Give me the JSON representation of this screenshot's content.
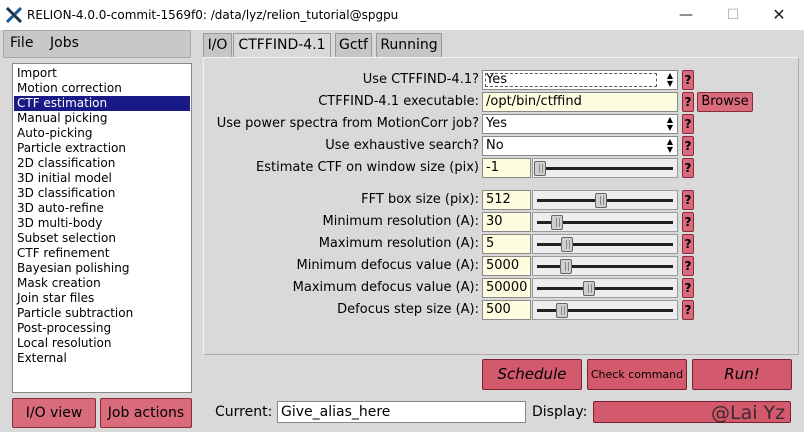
{
  "window": {
    "title": "RELION-4.0.0-commit-1569f0: /data/lyz/relion_tutorial@spgpu",
    "minimize": "—",
    "maximize": "☐",
    "close": "✕"
  },
  "menubar": {
    "file": "File",
    "jobs": "Jobs"
  },
  "job_types": [
    "Import",
    "Motion correction",
    "CTF estimation",
    "Manual picking",
    "Auto-picking",
    "Particle extraction",
    "2D classification",
    "3D initial model",
    "3D classification",
    "3D auto-refine",
    "3D multi-body",
    "Subset selection",
    "CTF refinement",
    "Bayesian polishing",
    "Mask creation",
    "Join star files",
    "Particle subtraction",
    "Post-processing",
    "Local resolution",
    "External"
  ],
  "selected_job_type": "CTF estimation",
  "left_buttons": {
    "io_view": "I/O view",
    "job_actions": "Job actions"
  },
  "tabs": [
    "I/O",
    "CTFFIND-4.1",
    "Gctf",
    "Running"
  ],
  "active_tab": "CTFFIND-4.1",
  "params": {
    "use_ctffind": {
      "label": "Use CTFFIND-4.1?",
      "value": "Yes"
    },
    "ctffind_exe": {
      "label": "CTFFIND-4.1 executable:",
      "value": "/opt/bin/ctffind",
      "browse": "Browse"
    },
    "use_power_spectra": {
      "label": "Use power spectra from MotionCorr job?",
      "value": "Yes"
    },
    "use_exhaustive": {
      "label": "Use exhaustive search?",
      "value": "No"
    },
    "window_size": {
      "label": "Estimate CTF on window size (pix)",
      "value": "-1",
      "level": 0.0
    },
    "fft_box": {
      "label": "FFT box size (pix):",
      "value": "512",
      "level": 0.47
    },
    "min_res": {
      "label": "Minimum resolution (A):",
      "value": "30",
      "level": 0.13
    },
    "max_res": {
      "label": "Maximum resolution (A):",
      "value": "5",
      "level": 0.21
    },
    "min_defocus": {
      "label": "Minimum defocus value (A):",
      "value": "5000",
      "level": 0.2
    },
    "max_defocus": {
      "label": "Maximum defocus value (A):",
      "value": "50000",
      "level": 0.38
    },
    "defocus_step": {
      "label": "Defocus step size (A):",
      "value": "500",
      "level": 0.17
    }
  },
  "help_symbol": "?",
  "actions": {
    "schedule": "Schedule",
    "check_command": "Check command",
    "run": "Run!"
  },
  "bottom": {
    "current_label": "Current:",
    "current_value": "Give_alias_here",
    "display_label": "Display:"
  },
  "watermark": "@Lai Yz",
  "colors": {
    "selection": "#1a1a86",
    "button": "#d96b7b",
    "input_bg": "#fffde0"
  }
}
